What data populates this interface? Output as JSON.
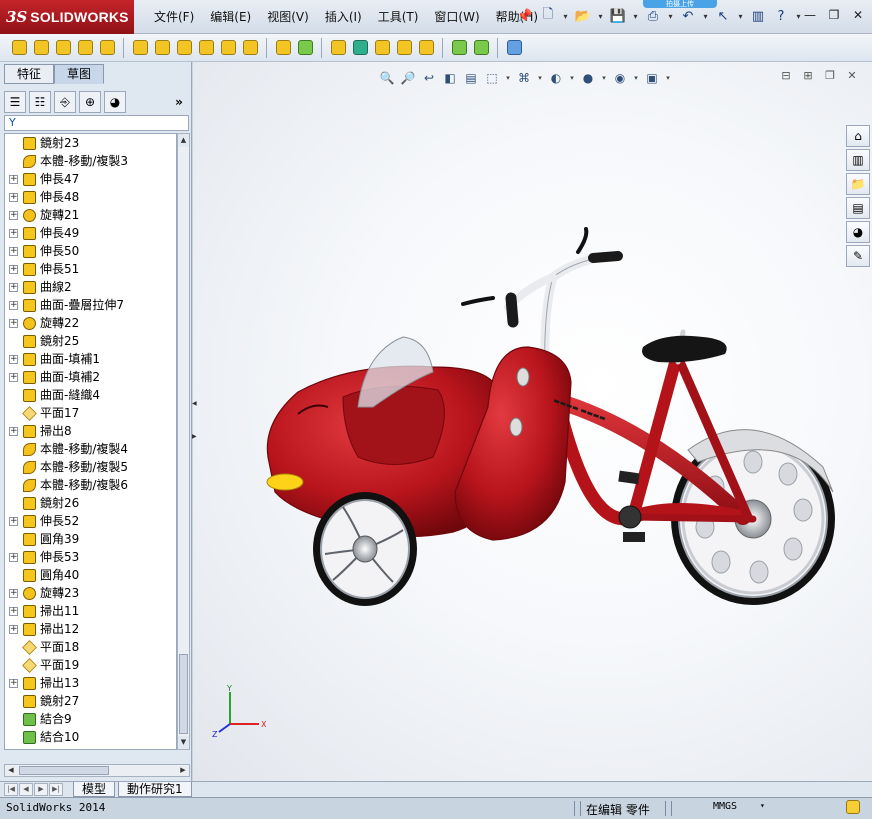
{
  "app": {
    "title_prefix": "3S",
    "title": "SOLIDWORKS",
    "upload_badge": "拍摄上传"
  },
  "menu": [
    "文件(F)",
    "编辑(E)",
    "视图(V)",
    "插入(I)",
    "工具(T)",
    "窗口(W)",
    "帮助(H)"
  ],
  "quick_toolbar": [
    "new-icon",
    "open-icon",
    "save-icon",
    "print-icon",
    "undo-icon",
    "select-icon",
    "rebuild-icon",
    "options-icon",
    "help-icon"
  ],
  "window_buttons": {
    "minimize": "—",
    "restore": "❐",
    "close": "✕"
  },
  "panel": {
    "tabs": [
      {
        "label": "特征"
      },
      {
        "label": "草图"
      }
    ],
    "filter_icon": "Y"
  },
  "tree": [
    {
      "label": "鏡射23",
      "icon": "mirror",
      "expand": false
    },
    {
      "label": "本體-移動/複製3",
      "icon": "move",
      "expand": false
    },
    {
      "label": "伸長47",
      "icon": "extrude",
      "expand": true
    },
    {
      "label": "伸長48",
      "icon": "extrude",
      "expand": true
    },
    {
      "label": "旋轉21",
      "icon": "revolve",
      "expand": true
    },
    {
      "label": "伸長49",
      "icon": "extrude",
      "expand": true
    },
    {
      "label": "伸長50",
      "icon": "extrude",
      "expand": true
    },
    {
      "label": "伸長51",
      "icon": "extrude",
      "expand": true
    },
    {
      "label": "曲線2",
      "icon": "curve",
      "expand": true
    },
    {
      "label": "曲面-疊層拉伸7",
      "icon": "loft",
      "expand": true
    },
    {
      "label": "旋轉22",
      "icon": "revolve",
      "expand": true
    },
    {
      "label": "鏡射25",
      "icon": "mirror",
      "expand": false
    },
    {
      "label": "曲面-填補1",
      "icon": "fill",
      "expand": true
    },
    {
      "label": "曲面-填補2",
      "icon": "fill",
      "expand": true
    },
    {
      "label": "曲面-縫織4",
      "icon": "knit",
      "expand": false
    },
    {
      "label": "平面17",
      "icon": "plane",
      "expand": false
    },
    {
      "label": "掃出8",
      "icon": "sweep",
      "expand": true
    },
    {
      "label": "本體-移動/複製4",
      "icon": "move",
      "expand": false
    },
    {
      "label": "本體-移動/複製5",
      "icon": "move",
      "expand": false
    },
    {
      "label": "本體-移動/複製6",
      "icon": "move",
      "expand": false
    },
    {
      "label": "鏡射26",
      "icon": "mirror",
      "expand": false
    },
    {
      "label": "伸長52",
      "icon": "extrude",
      "expand": true
    },
    {
      "label": "圓角39",
      "icon": "fillet",
      "expand": false
    },
    {
      "label": "伸長53",
      "icon": "extrude",
      "expand": true
    },
    {
      "label": "圓角40",
      "icon": "fillet",
      "expand": false
    },
    {
      "label": "旋轉23",
      "icon": "revolve",
      "expand": true
    },
    {
      "label": "掃出11",
      "icon": "sweep",
      "expand": true
    },
    {
      "label": "掃出12",
      "icon": "sweep",
      "expand": true
    },
    {
      "label": "平面18",
      "icon": "plane",
      "expand": false
    },
    {
      "label": "平面19",
      "icon": "plane",
      "expand": false
    },
    {
      "label": "掃出13",
      "icon": "sweep",
      "expand": true
    },
    {
      "label": "鏡射27",
      "icon": "mirror",
      "expand": false
    },
    {
      "label": "結合9",
      "icon": "body",
      "expand": false
    },
    {
      "label": "結合10",
      "icon": "body",
      "expand": false
    }
  ],
  "bottom_tabs": [
    "模型",
    "動作研究1"
  ],
  "status": {
    "product": "SolidWorks 2014",
    "mode": "在编辑 零件",
    "units": "MMGS"
  },
  "colors": {
    "brand_red": "#b8141c",
    "body_red": "#c4141c",
    "panel_bg": "#dfe7f1"
  },
  "triad_labels": {
    "x": "X",
    "y": "Y",
    "z": "Z"
  }
}
